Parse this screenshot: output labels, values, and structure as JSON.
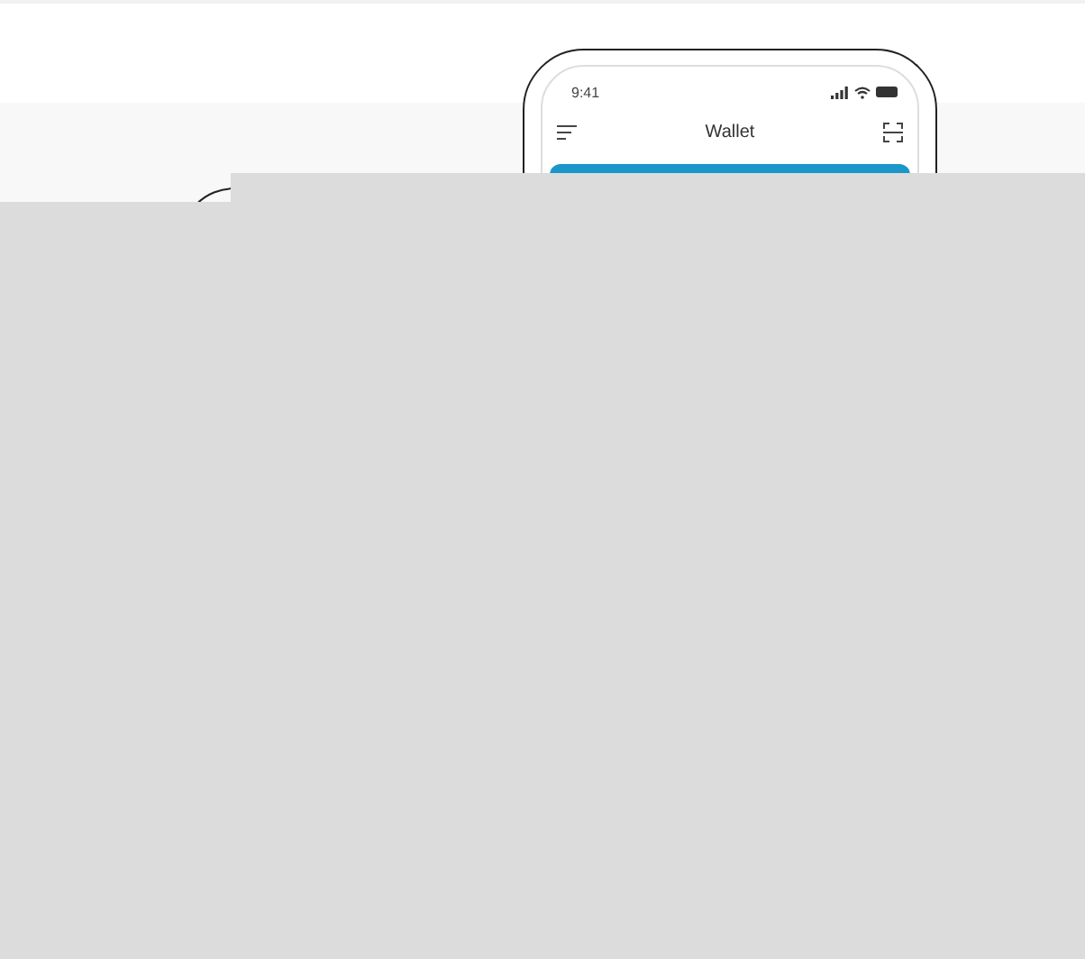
{
  "phone": {
    "status_bar": {
      "time": "9:41"
    },
    "nav_bar": {
      "title": "Wallet"
    }
  }
}
